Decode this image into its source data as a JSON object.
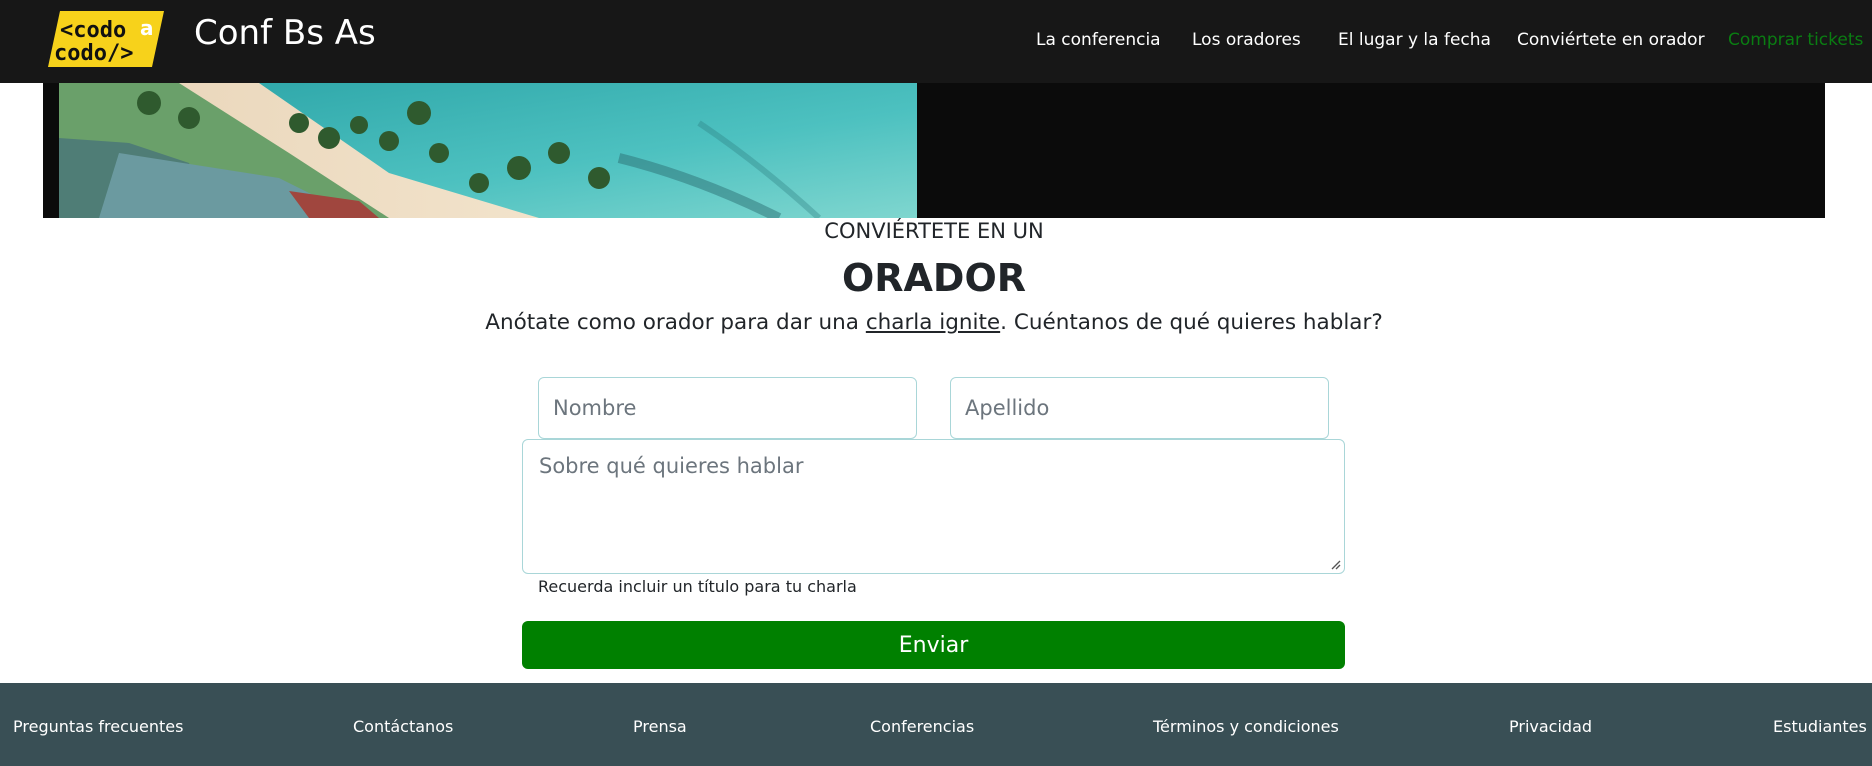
{
  "header": {
    "logo_lines": [
      "<codo",
      "a",
      "codo/>"
    ],
    "brand": "Conf Bs As",
    "nav": [
      {
        "label": "La conferencia"
      },
      {
        "label": "Los oradores"
      },
      {
        "label": "El lugar y la fecha"
      },
      {
        "label": "Conviértete en orador"
      },
      {
        "label": "Comprar tickets"
      }
    ],
    "colors": {
      "background": "#171717",
      "tickets_link": "#0a7d12",
      "logo": "#f7d21b"
    }
  },
  "banner": {
    "image": "beach-aerial-photo"
  },
  "form_section": {
    "eyebrow": "CONVIÉRTETE EN UN",
    "title": "ORADOR",
    "lead_before": "Anótate como orador para dar una ",
    "lead_link": "charla ignite",
    "lead_after": ". Cuéntanos de qué quieres hablar?",
    "fields": {
      "nombre_placeholder": "Nombre",
      "apellido_placeholder": "Apellido",
      "tema_placeholder": "Sobre qué quieres hablar"
    },
    "hint": "Recuerda incluir un título para tu charla",
    "submit_label": "Enviar",
    "colors": {
      "submit": "#008000",
      "field_border": "#a9d6d8"
    }
  },
  "footer": {
    "links": [
      {
        "label": "Preguntas frecuentes"
      },
      {
        "label": "Contáctanos"
      },
      {
        "label": "Prensa"
      },
      {
        "label": "Conferencias"
      },
      {
        "label": "Términos y condiciones"
      },
      {
        "label": "Privacidad"
      },
      {
        "label": "Estudiantes"
      }
    ],
    "colors": {
      "background": "#394f55"
    }
  }
}
